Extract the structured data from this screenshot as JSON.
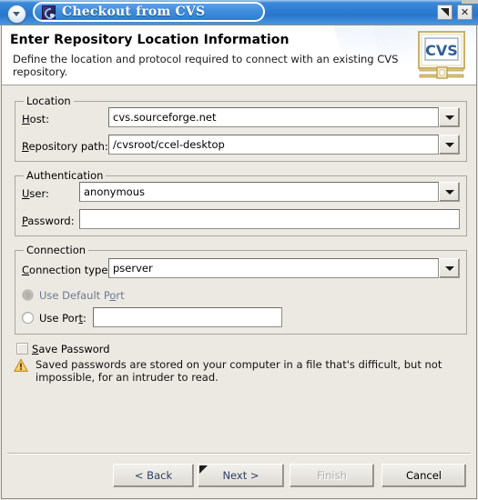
{
  "window": {
    "title": "Checkout from CVS",
    "app_icon": "eclipse-cvs-icon",
    "menu_button_icon": "window-menu-chevron-down-icon",
    "restore_button_icon": "restore-window-icon",
    "close_button_label": "✕"
  },
  "header": {
    "title": "Enter Repository Location Information",
    "description": "Define the location and protocol required to connect with an existing CVS repository.",
    "logo_text": "CVS"
  },
  "location": {
    "legend": "Location",
    "host": {
      "label_prefix": "H",
      "label_mnemonic": "H",
      "label": "Host:",
      "value": "cvs.sourceforge.net"
    },
    "repository_path": {
      "label": "Repository path:",
      "value": "/cvsroot/ccel-desktop"
    }
  },
  "authentication": {
    "legend": "Authentication",
    "user": {
      "label": "User:",
      "value": "anonymous"
    },
    "password": {
      "label": "Password:",
      "value": ""
    }
  },
  "connection": {
    "legend": "Connection",
    "connection_type": {
      "label": "Connection type:",
      "value": "pserver"
    },
    "use_default_port": {
      "label": "Use Default Port",
      "selected": true,
      "disabled": true
    },
    "use_port": {
      "label": "Use Port:",
      "selected": false,
      "value": ""
    }
  },
  "save_password": {
    "label": "Save Password",
    "checked": false
  },
  "warning": {
    "icon": "warning-triangle-icon",
    "text": "Saved passwords are stored on your computer in a file that's difficult, but not impossible, for an intruder to read."
  },
  "buttons": {
    "back": "< Back",
    "next": "Next >",
    "finish": "Finish",
    "cancel": "Cancel"
  },
  "colors": {
    "titlebar_blue": "#2f7ed3",
    "dialog_bg": "#ece9e3",
    "field_bg": "#ffffff",
    "link_blue": "#2d3f63",
    "disabled_gray": "#b3b0a9",
    "disabled_label": "#6b7a93",
    "warning_amber": "#e8a317"
  }
}
